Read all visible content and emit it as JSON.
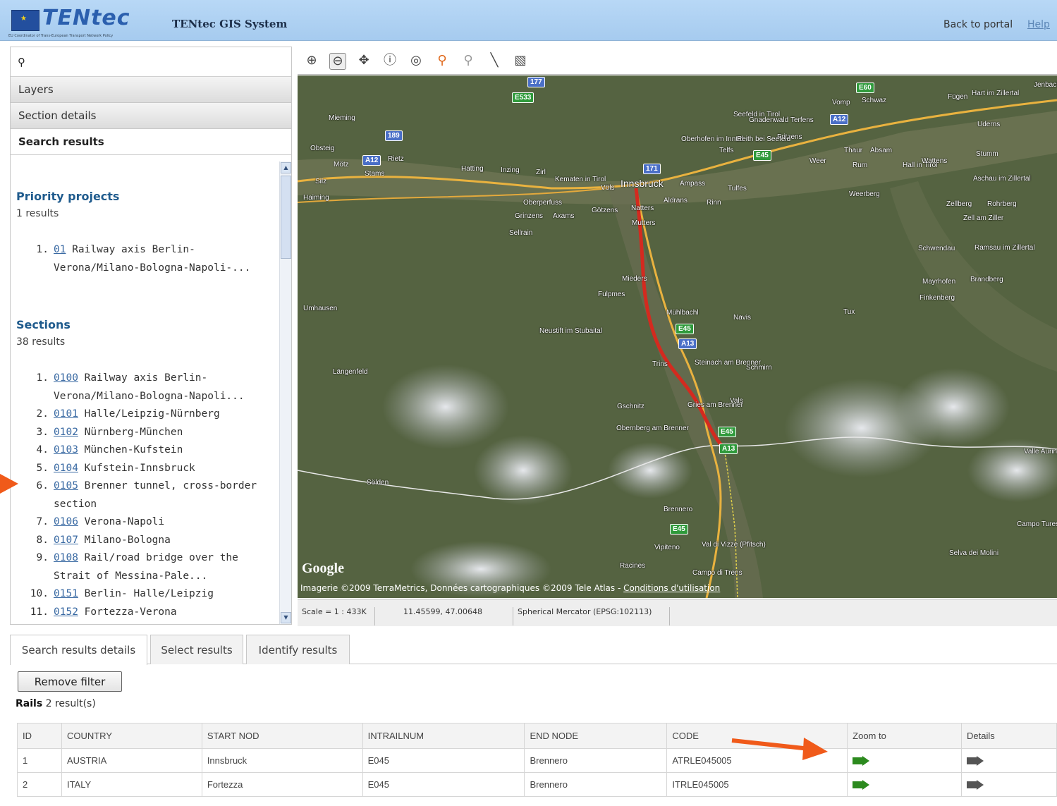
{
  "header": {
    "logo_text": "TENtec",
    "logo_subtext": "EU Coordinator of Trans-European Transport Network Policy",
    "app_title": "TENtec GIS System",
    "back_to_portal": "Back to portal",
    "help": "Help"
  },
  "left_panel": {
    "accordion": [
      "Layers",
      "Section details",
      "Search results"
    ],
    "priority_projects": {
      "title": "Priority projects",
      "count": "1 results",
      "items": [
        {
          "num": "1.",
          "code": "01",
          "text": "Railway axis Berlin-Verona/Milano-Bologna-Napoli-..."
        }
      ]
    },
    "sections": {
      "title": "Sections",
      "count": "38 results",
      "items": [
        {
          "num": "1.",
          "code": "0100",
          "text": "Railway axis Berlin-Verona/Milano-Bologna-Napoli..."
        },
        {
          "num": "2.",
          "code": "0101",
          "text": "Halle/Leipzig-Nürnberg"
        },
        {
          "num": "3.",
          "code": "0102",
          "text": "Nürnberg-München"
        },
        {
          "num": "4.",
          "code": "0103",
          "text": "München-Kufstein"
        },
        {
          "num": "5.",
          "code": "0104",
          "text": "Kufstein-Innsbruck"
        },
        {
          "num": "6.",
          "code": "0105",
          "text": "Brenner tunnel, cross-border section"
        },
        {
          "num": "7.",
          "code": "0106",
          "text": "Verona-Napoli"
        },
        {
          "num": "8.",
          "code": "0107",
          "text": "Milano-Bologna"
        },
        {
          "num": "9.",
          "code": "0108",
          "text": "Rail/road bridge over the Strait of Messina-Pale..."
        },
        {
          "num": "10.",
          "code": "0151",
          "text": "Berlin- Halle/Leipzig"
        },
        {
          "num": "11.",
          "code": "0152",
          "text": "Fortezza-Verona"
        }
      ]
    }
  },
  "map": {
    "attribution": "Imagerie ©2009 TerraMetrics, Données cartographiques ©2009 Tele Atlas -",
    "attribution_link": "Conditions d'utilisation",
    "google": "Google",
    "places": [
      {
        "name": "Innsbruck"
      },
      {
        "name": "Schwaz"
      },
      {
        "name": "Vomp"
      },
      {
        "name": "Jenbach"
      },
      {
        "name": "Hall in Tirol"
      },
      {
        "name": "Absam"
      },
      {
        "name": "Thaur"
      },
      {
        "name": "Rum"
      },
      {
        "name": "Wattens"
      },
      {
        "name": "Fritzens"
      },
      {
        "name": "Weer"
      },
      {
        "name": "Terfens"
      },
      {
        "name": "Gnadenwald"
      },
      {
        "name": "Telfs"
      },
      {
        "name": "Oberhofen im Inntal"
      },
      {
        "name": "Reith bei Seefeld"
      },
      {
        "name": "Seefeld in Tirol"
      },
      {
        "name": "Mieming"
      },
      {
        "name": "Obsteig"
      },
      {
        "name": "Mötz"
      },
      {
        "name": "Stams"
      },
      {
        "name": "Rietz"
      },
      {
        "name": "Hatting"
      },
      {
        "name": "Inzing"
      },
      {
        "name": "Zirl"
      },
      {
        "name": "Kematen in Tirol"
      },
      {
        "name": "Völs"
      },
      {
        "name": "Ampass"
      },
      {
        "name": "Tulfes"
      },
      {
        "name": "Aldrans"
      },
      {
        "name": "Rinn"
      },
      {
        "name": "Oberperfuss"
      },
      {
        "name": "Götzens"
      },
      {
        "name": "Natters"
      },
      {
        "name": "Mutters"
      },
      {
        "name": "Grinzens"
      },
      {
        "name": "Axams"
      },
      {
        "name": "Sellrain"
      },
      {
        "name": "Mieders"
      },
      {
        "name": "Fulpmes"
      },
      {
        "name": "Mühlbachl"
      },
      {
        "name": "Navis"
      },
      {
        "name": "Neustift im Stubaital"
      },
      {
        "name": "Umhausen"
      },
      {
        "name": "Längenfeld"
      },
      {
        "name": "Trins"
      },
      {
        "name": "Steinach am Brenner"
      },
      {
        "name": "Schmirn"
      },
      {
        "name": "Gschnitz"
      },
      {
        "name": "Gries am Brenner"
      },
      {
        "name": "Vals"
      },
      {
        "name": "Obernberg am Brenner"
      },
      {
        "name": "Sölden"
      },
      {
        "name": "Brennero"
      },
      {
        "name": "Vipiteno"
      },
      {
        "name": "Val di Vizze (Pfitsch)"
      },
      {
        "name": "Racines"
      },
      {
        "name": "Campo di Trens"
      },
      {
        "name": "Weerberg"
      },
      {
        "name": "Tux"
      },
      {
        "name": "Mayrhofen"
      },
      {
        "name": "Brandberg"
      },
      {
        "name": "Finkenberg"
      },
      {
        "name": "Schwendau"
      },
      {
        "name": "Ramsau im Zillertal"
      },
      {
        "name": "Zellberg"
      },
      {
        "name": "Rohrberg"
      },
      {
        "name": "Zell am Ziller"
      },
      {
        "name": "Aschau im Zillertal"
      },
      {
        "name": "Stumm"
      },
      {
        "name": "Uderns"
      },
      {
        "name": "Fügen"
      },
      {
        "name": "Hart im Zillertal"
      },
      {
        "name": "Haiming"
      },
      {
        "name": "Silz"
      },
      {
        "name": "Valle Aurina"
      },
      {
        "name": "Campo Tures"
      },
      {
        "name": "Selva dei Molini"
      }
    ],
    "shields": [
      {
        "text": "177",
        "kind": "blue"
      },
      {
        "text": "E533",
        "kind": "green"
      },
      {
        "text": "189",
        "kind": "blue"
      },
      {
        "text": "A12",
        "kind": "blue"
      },
      {
        "text": "171",
        "kind": "blue"
      },
      {
        "text": "E45",
        "kind": "green"
      },
      {
        "text": "E60",
        "kind": "green"
      },
      {
        "text": "A12",
        "kind": "blue"
      },
      {
        "text": "E45",
        "kind": "green"
      },
      {
        "text": "A13",
        "kind": "blue"
      },
      {
        "text": "E45",
        "kind": "green"
      },
      {
        "text": "A13",
        "kind": "green"
      },
      {
        "text": "E45",
        "kind": "green"
      }
    ]
  },
  "statusbar": {
    "scale": "Scale = 1 : 433K",
    "coords": "11.45599, 47.00648",
    "projection": "Spherical Mercator (EPSG:102113)"
  },
  "bottom": {
    "tabs": [
      "Search results details",
      "Select results",
      "Identify results"
    ],
    "remove_filter": "Remove filter",
    "rails_label": "Rails",
    "rails_count": "2 result(s)",
    "table": {
      "headers": [
        "ID",
        "COUNTRY",
        "START NOD",
        "INTRAILNUM",
        "END NODE",
        "CODE",
        "Zoom to",
        "Details"
      ],
      "rows": [
        [
          "1",
          "AUSTRIA",
          "Innsbruck",
          "E045",
          "Brennero",
          "ATRLE045005"
        ],
        [
          "2",
          "ITALY",
          "Fortezza",
          "E045",
          "Brennero",
          "ITRLE045005"
        ]
      ]
    }
  },
  "colors": {
    "header_bg": "#a6cbef",
    "link": "#3a6aa3",
    "section_title": "#1f5b8d",
    "annotation_arrow": "#f05a1a",
    "route": "#d42a1f"
  }
}
